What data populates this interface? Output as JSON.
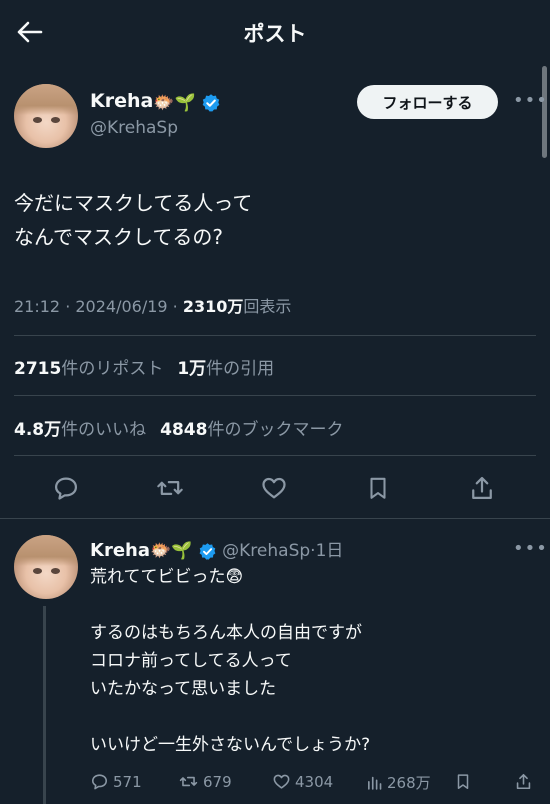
{
  "header": {
    "title": "ポスト"
  },
  "post": {
    "display_name": "Kreha",
    "name_emoji": "🐡🌱",
    "handle": "@KrehaSp",
    "follow_label": "フォローする",
    "text_line1": "今だにマスクしてる人って",
    "text_line2": "なんでマスクしてるの?",
    "time": "21:12",
    "date": "2024/06/19",
    "views_value": "2310万",
    "views_label": "回表示",
    "reposts_value": "2715",
    "reposts_label": "件のリポスト",
    "quotes_value": "1万",
    "quotes_label": "件の引用",
    "likes_value": "4.8万",
    "likes_label": "件のいいね",
    "bookmarks_value": "4848",
    "bookmarks_label": "件のブックマーク"
  },
  "reply": {
    "display_name": "Kreha",
    "name_emoji": "🐡🌱",
    "handle": "@KrehaSp",
    "age": "1日",
    "line1": "荒れててビビった😨",
    "line2": "するのはもちろん本人の自由ですが",
    "line3": "コロナ前ってしてる人って",
    "line4": "いたかなって思いました",
    "line5": "いいけど一生外さないんでしょうか?",
    "reply_count": "571",
    "repost_count": "679",
    "like_count": "4304",
    "view_count": "268万"
  },
  "colors": {
    "background": "#15202b",
    "accent": "#1d9bf0",
    "muted": "#8b98a5",
    "divider": "#38444d"
  },
  "icons": [
    "back-arrow-icon",
    "verified-badge-icon",
    "more-icon",
    "reply-icon",
    "repost-icon",
    "like-icon",
    "bookmark-icon",
    "share-icon",
    "views-icon"
  ]
}
